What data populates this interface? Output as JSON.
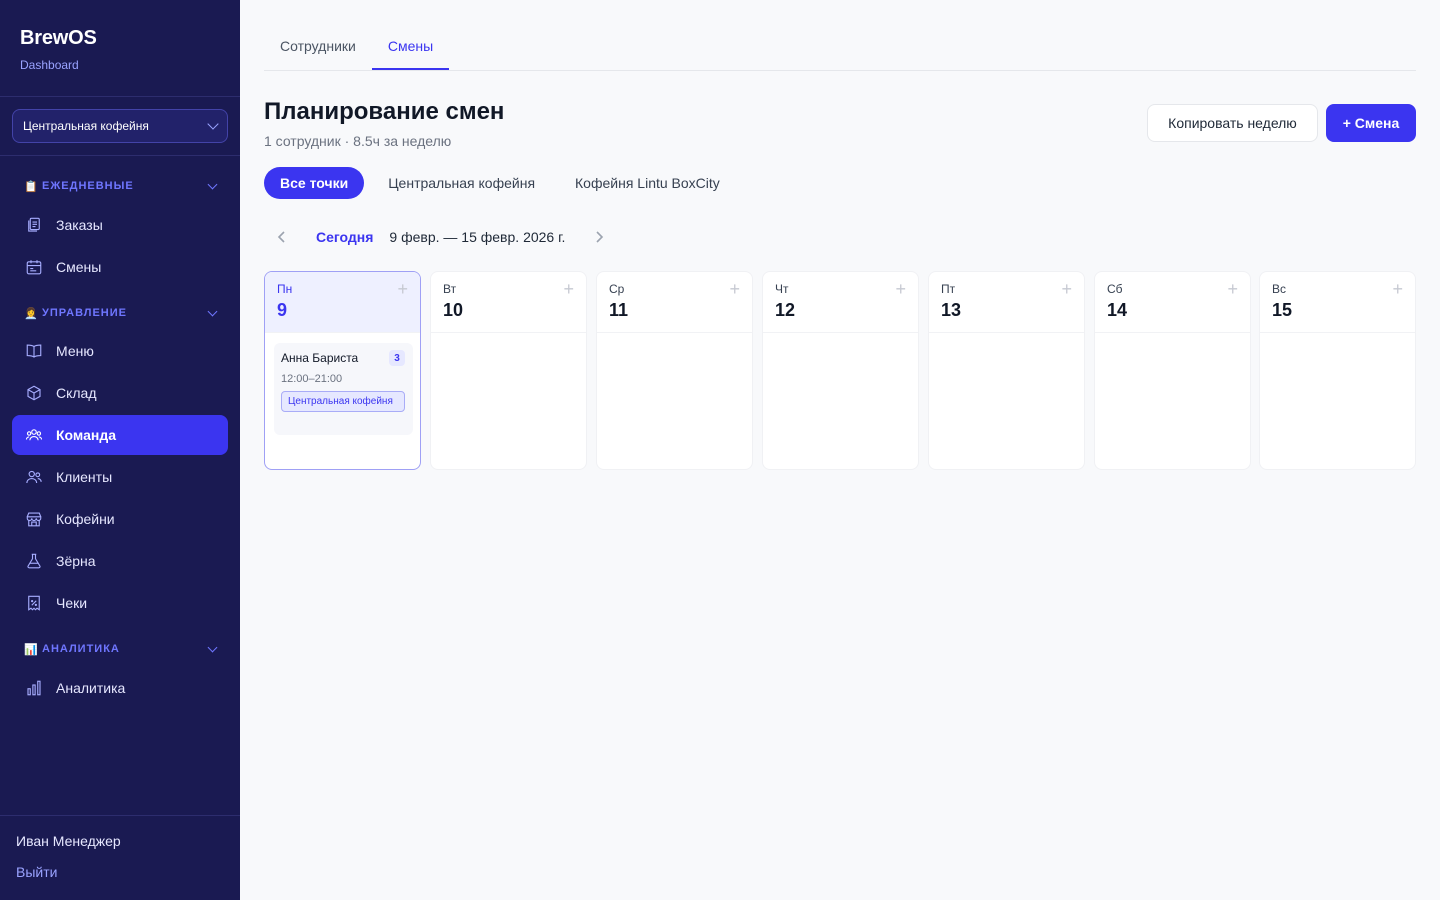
{
  "brand": {
    "title": "BrewOS",
    "subtitle": "Dashboard"
  },
  "store_select": {
    "value": "Центральная кофейня"
  },
  "sidebar": {
    "sections": [
      {
        "label": "ЕЖЕДНЕВНЫЕ",
        "icon": "clipboard-emoji",
        "glyph": "📋"
      },
      {
        "label": "УПРАВЛЕНИЕ",
        "icon": "manager-emoji",
        "glyph": "👩‍💼"
      },
      {
        "label": "АНАЛИТИКА",
        "icon": "chart-emoji",
        "glyph": "📊"
      }
    ],
    "items": [
      {
        "label": "Заказы",
        "icon": "orders-icon"
      },
      {
        "label": "Смены",
        "icon": "calendar-icon"
      },
      {
        "label": "Меню",
        "icon": "book-icon"
      },
      {
        "label": "Склад",
        "icon": "box-icon"
      },
      {
        "label": "Команда",
        "icon": "team-icon",
        "active": true
      },
      {
        "label": "Клиенты",
        "icon": "users-icon"
      },
      {
        "label": "Кофейни",
        "icon": "store-icon"
      },
      {
        "label": "Зёрна",
        "icon": "flask-icon"
      },
      {
        "label": "Чеки",
        "icon": "receipt-icon"
      },
      {
        "label": "Аналитика",
        "icon": "bar-chart-icon"
      }
    ]
  },
  "footer": {
    "user": "Иван Менеджер",
    "logout": "Выйти"
  },
  "tabs": [
    {
      "label": "Сотрудники",
      "active": false
    },
    {
      "label": "Смены",
      "active": true
    }
  ],
  "header": {
    "title": "Планирование смен",
    "subtitle": "1 сотрудник · 8.5ч за неделю",
    "copy_button": "Копировать неделю",
    "add_button": "+ Смена"
  },
  "filters": [
    {
      "label": "Все точки",
      "active": true
    },
    {
      "label": "Центральная кофейня",
      "active": false
    },
    {
      "label": "Кофейня Lintu BoxCity",
      "active": false
    }
  ],
  "week_nav": {
    "today": "Сегодня",
    "range": "9 февр. — 15 февр. 2026 г."
  },
  "days": [
    {
      "dow": "Пн",
      "num": "9",
      "today": true
    },
    {
      "dow": "Вт",
      "num": "10"
    },
    {
      "dow": "Ср",
      "num": "11"
    },
    {
      "dow": "Чт",
      "num": "12"
    },
    {
      "dow": "Пт",
      "num": "13"
    },
    {
      "dow": "Сб",
      "num": "14"
    },
    {
      "dow": "Вс",
      "num": "15"
    }
  ],
  "shifts": [
    {
      "name": "Анна Бариста",
      "badge": "3",
      "time": "12:00–21:00",
      "location": "Центральная кофейня"
    }
  ],
  "colors": {
    "sidebar_bg": "#1a1a52",
    "accent": "#3b35f0",
    "section_label": "#6f76ff"
  }
}
